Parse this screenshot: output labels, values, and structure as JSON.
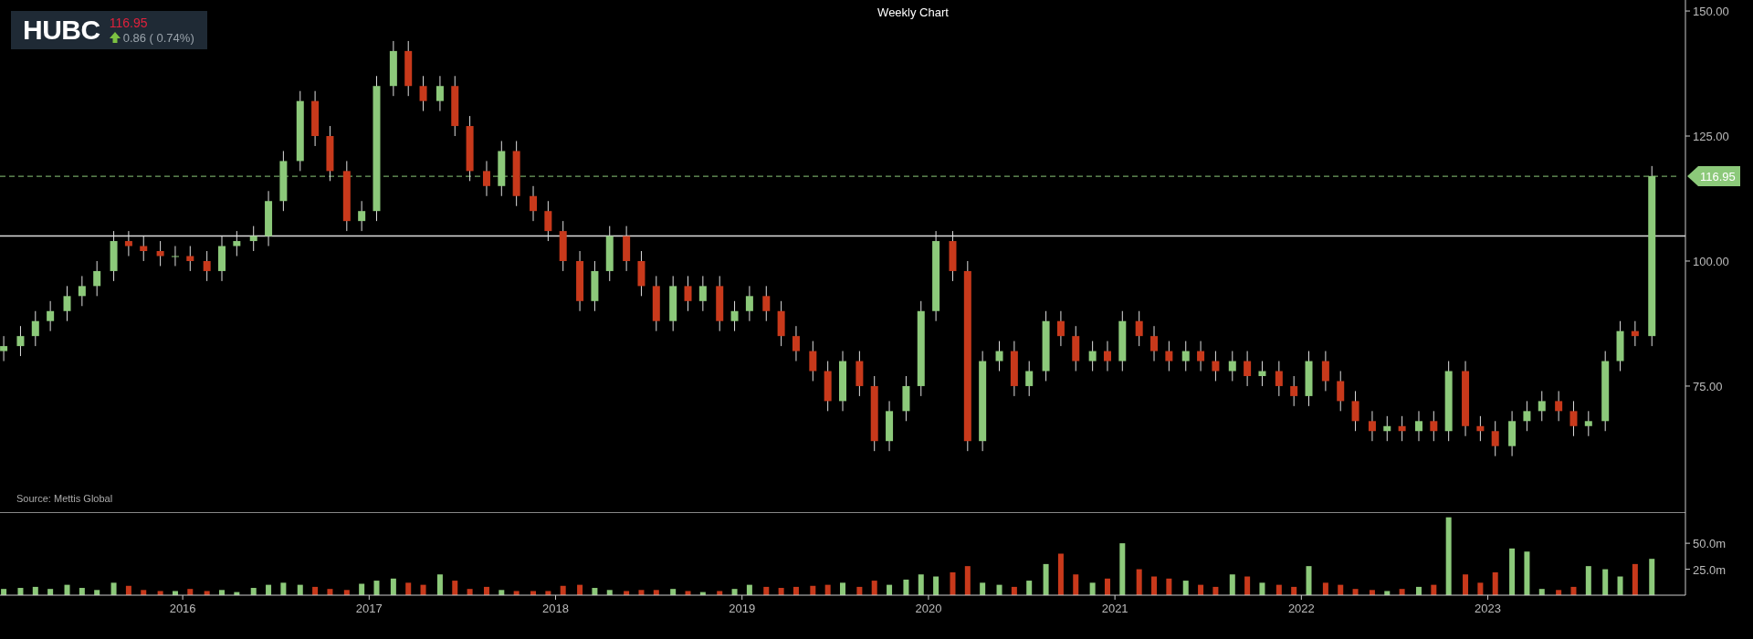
{
  "ticker": {
    "symbol": "HUBC",
    "price": "116.95",
    "change": "0.86 ( 0.74%)",
    "up": true
  },
  "price_chart": {
    "chart_data": {
      "type": "candlestick",
      "title": "Weekly Chart",
      "x": [
        2015.04,
        2015.13,
        2015.21,
        2015.29,
        2015.38,
        2015.46,
        2015.54,
        2015.63,
        2015.71,
        2015.79,
        2015.88,
        2015.96,
        2016.04,
        2016.13,
        2016.21,
        2016.29,
        2016.38,
        2016.46,
        2016.54,
        2016.63,
        2016.71,
        2016.79,
        2016.88,
        2016.96,
        2017.04,
        2017.13,
        2017.21,
        2017.29,
        2017.38,
        2017.46,
        2017.54,
        2017.63,
        2017.71,
        2017.79,
        2017.88,
        2017.96,
        2018.04,
        2018.13,
        2018.21,
        2018.29,
        2018.38,
        2018.46,
        2018.54,
        2018.63,
        2018.71,
        2018.79,
        2018.88,
        2018.96,
        2019.04,
        2019.13,
        2019.21,
        2019.29,
        2019.38,
        2019.46,
        2019.54,
        2019.63,
        2019.71,
        2019.79,
        2019.88,
        2019.96,
        2020.04,
        2020.13,
        2020.21,
        2020.29,
        2020.38,
        2020.46,
        2020.54,
        2020.63,
        2020.71,
        2020.79,
        2020.88,
        2020.96,
        2021.04,
        2021.13,
        2021.21,
        2021.29,
        2021.38,
        2021.46,
        2021.54,
        2021.63,
        2021.71,
        2021.79,
        2021.88,
        2021.96,
        2022.04,
        2022.13,
        2022.21,
        2022.29,
        2022.38,
        2022.46,
        2022.54,
        2022.63,
        2022.71,
        2022.79,
        2022.88,
        2022.96,
        2023.04,
        2023.13,
        2023.21,
        2023.29,
        2023.38,
        2023.46,
        2023.54,
        2023.63,
        2023.71,
        2023.79,
        2023.88
      ],
      "ohlc": [
        [
          82,
          85,
          80,
          83
        ],
        [
          83,
          87,
          81,
          85
        ],
        [
          85,
          90,
          83,
          88
        ],
        [
          88,
          92,
          86,
          90
        ],
        [
          90,
          95,
          88,
          93
        ],
        [
          93,
          97,
          91,
          95
        ],
        [
          95,
          100,
          93,
          98
        ],
        [
          98,
          106,
          96,
          104
        ],
        [
          104,
          106,
          101,
          103
        ],
        [
          103,
          105,
          100,
          102
        ],
        [
          102,
          104,
          99,
          101
        ],
        [
          101,
          103,
          99,
          101
        ],
        [
          101,
          103,
          98,
          100
        ],
        [
          100,
          102,
          96,
          98
        ],
        [
          98,
          105,
          96,
          103
        ],
        [
          103,
          106,
          101,
          104
        ],
        [
          104,
          107,
          102,
          105
        ],
        [
          105,
          114,
          103,
          112
        ],
        [
          112,
          122,
          110,
          120
        ],
        [
          120,
          134,
          118,
          132
        ],
        [
          132,
          134,
          123,
          125
        ],
        [
          125,
          127,
          116,
          118
        ],
        [
          118,
          120,
          106,
          108
        ],
        [
          108,
          112,
          106,
          110
        ],
        [
          110,
          137,
          108,
          135
        ],
        [
          135,
          144,
          133,
          142
        ],
        [
          142,
          144,
          133,
          135
        ],
        [
          135,
          137,
          130,
          132
        ],
        [
          132,
          137,
          130,
          135
        ],
        [
          135,
          137,
          125,
          127
        ],
        [
          127,
          129,
          116,
          118
        ],
        [
          118,
          120,
          113,
          115
        ],
        [
          115,
          124,
          113,
          122
        ],
        [
          122,
          124,
          111,
          113
        ],
        [
          113,
          115,
          108,
          110
        ],
        [
          110,
          112,
          104,
          106
        ],
        [
          106,
          108,
          98,
          100
        ],
        [
          100,
          102,
          90,
          92
        ],
        [
          92,
          100,
          90,
          98
        ],
        [
          98,
          107,
          96,
          105
        ],
        [
          105,
          107,
          98,
          100
        ],
        [
          100,
          102,
          93,
          95
        ],
        [
          95,
          97,
          86,
          88
        ],
        [
          88,
          97,
          86,
          95
        ],
        [
          95,
          97,
          90,
          92
        ],
        [
          92,
          97,
          90,
          95
        ],
        [
          95,
          97,
          86,
          88
        ],
        [
          88,
          92,
          86,
          90
        ],
        [
          90,
          95,
          88,
          93
        ],
        [
          93,
          95,
          88,
          90
        ],
        [
          90,
          92,
          83,
          85
        ],
        [
          85,
          87,
          80,
          82
        ],
        [
          82,
          84,
          76,
          78
        ],
        [
          78,
          80,
          70,
          72
        ],
        [
          72,
          82,
          70,
          80
        ],
        [
          80,
          82,
          73,
          75
        ],
        [
          75,
          77,
          62,
          64
        ],
        [
          64,
          72,
          62,
          70
        ],
        [
          70,
          77,
          68,
          75
        ],
        [
          75,
          92,
          73,
          90
        ],
        [
          90,
          106,
          88,
          104
        ],
        [
          104,
          106,
          96,
          98
        ],
        [
          98,
          100,
          62,
          64
        ],
        [
          64,
          82,
          62,
          80
        ],
        [
          80,
          84,
          78,
          82
        ],
        [
          82,
          84,
          73,
          75
        ],
        [
          75,
          80,
          73,
          78
        ],
        [
          78,
          90,
          76,
          88
        ],
        [
          88,
          90,
          83,
          85
        ],
        [
          85,
          87,
          78,
          80
        ],
        [
          80,
          84,
          78,
          82
        ],
        [
          82,
          84,
          78,
          80
        ],
        [
          80,
          90,
          78,
          88
        ],
        [
          88,
          90,
          83,
          85
        ],
        [
          85,
          87,
          80,
          82
        ],
        [
          82,
          84,
          78,
          80
        ],
        [
          80,
          84,
          78,
          82
        ],
        [
          82,
          84,
          78,
          80
        ],
        [
          80,
          82,
          76,
          78
        ],
        [
          78,
          82,
          76,
          80
        ],
        [
          80,
          82,
          75,
          77
        ],
        [
          77,
          80,
          75,
          78
        ],
        [
          78,
          80,
          73,
          75
        ],
        [
          75,
          77,
          71,
          73
        ],
        [
          73,
          82,
          71,
          80
        ],
        [
          80,
          82,
          74,
          76
        ],
        [
          76,
          78,
          70,
          72
        ],
        [
          72,
          74,
          66,
          68
        ],
        [
          68,
          70,
          64,
          66
        ],
        [
          66,
          69,
          64,
          67
        ],
        [
          67,
          69,
          64,
          66
        ],
        [
          66,
          70,
          64,
          68
        ],
        [
          68,
          70,
          64,
          66
        ],
        [
          66,
          80,
          64,
          78
        ],
        [
          78,
          80,
          65,
          67
        ],
        [
          67,
          69,
          64,
          66
        ],
        [
          66,
          68,
          61,
          63
        ],
        [
          63,
          70,
          61,
          68
        ],
        [
          68,
          72,
          66,
          70
        ],
        [
          70,
          74,
          68,
          72
        ],
        [
          72,
          74,
          68,
          70
        ],
        [
          70,
          72,
          65,
          67
        ],
        [
          67,
          70,
          65,
          68
        ],
        [
          68,
          82,
          66,
          80
        ],
        [
          80,
          88,
          78,
          86
        ],
        [
          86,
          88,
          83,
          85
        ],
        [
          85,
          119,
          83,
          117
        ]
      ],
      "xlim": [
        2015.02,
        2024.06
      ],
      "ylim": [
        49.8,
        152.2
      ],
      "xticks": [
        {
          "value": 2016,
          "label": "2016"
        },
        {
          "value": 2017,
          "label": "2017"
        },
        {
          "value": 2018,
          "label": "2018"
        },
        {
          "value": 2019,
          "label": "2019"
        },
        {
          "value": 2020,
          "label": "2020"
        },
        {
          "value": 2021,
          "label": "2021"
        },
        {
          "value": 2022,
          "label": "2022"
        },
        {
          "value": 2023,
          "label": "2023"
        }
      ],
      "yticks": [
        {
          "value": 150,
          "label": "150.00"
        },
        {
          "value": 125,
          "label": "125.00"
        },
        {
          "value": 100,
          "label": "100.00"
        },
        {
          "value": 75,
          "label": "75.00"
        }
      ],
      "ref_lines": [
        {
          "axis": "y",
          "value": 105,
          "color": "#dddddd"
        },
        {
          "axis": "y",
          "value": 116.95,
          "color": "#8cc97a",
          "line_style": "dashed",
          "label": "116.95"
        }
      ]
    },
    "source": "Source: Mettis Global"
  },
  "volume_chart": {
    "chart_data": {
      "type": "bar",
      "x": [
        2015.04,
        2015.13,
        2015.21,
        2015.29,
        2015.38,
        2015.46,
        2015.54,
        2015.63,
        2015.71,
        2015.79,
        2015.88,
        2015.96,
        2016.04,
        2016.13,
        2016.21,
        2016.29,
        2016.38,
        2016.46,
        2016.54,
        2016.63,
        2016.71,
        2016.79,
        2016.88,
        2016.96,
        2017.04,
        2017.13,
        2017.21,
        2017.29,
        2017.38,
        2017.46,
        2017.54,
        2017.63,
        2017.71,
        2017.79,
        2017.88,
        2017.96,
        2018.04,
        2018.13,
        2018.21,
        2018.29,
        2018.38,
        2018.46,
        2018.54,
        2018.63,
        2018.71,
        2018.79,
        2018.88,
        2018.96,
        2019.04,
        2019.13,
        2019.21,
        2019.29,
        2019.38,
        2019.46,
        2019.54,
        2019.63,
        2019.71,
        2019.79,
        2019.88,
        2019.96,
        2020.04,
        2020.13,
        2020.21,
        2020.29,
        2020.38,
        2020.46,
        2020.54,
        2020.63,
        2020.71,
        2020.79,
        2020.88,
        2020.96,
        2021.04,
        2021.13,
        2021.21,
        2021.29,
        2021.38,
        2021.46,
        2021.54,
        2021.63,
        2021.71,
        2021.79,
        2021.88,
        2021.96,
        2022.04,
        2022.13,
        2022.21,
        2022.29,
        2022.38,
        2022.46,
        2022.54,
        2022.63,
        2022.71,
        2022.79,
        2022.88,
        2022.96,
        2023.04,
        2023.13,
        2023.21,
        2023.29,
        2023.38,
        2023.46,
        2023.54,
        2023.63,
        2023.71,
        2023.79,
        2023.88
      ],
      "values": [
        6,
        7,
        8,
        6,
        10,
        7,
        5,
        12,
        9,
        5,
        4,
        4,
        6,
        4,
        5,
        3,
        7,
        10,
        12,
        10,
        8,
        6,
        5,
        11,
        14,
        16,
        12,
        10,
        20,
        14,
        6,
        8,
        5,
        4,
        4,
        4,
        9,
        10,
        7,
        5,
        4,
        5,
        5,
        6,
        4,
        3,
        4,
        6,
        10,
        8,
        7,
        8,
        9,
        10,
        12,
        8,
        14,
        10,
        15,
        20,
        18,
        22,
        28,
        12,
        10,
        8,
        14,
        30,
        40,
        20,
        12,
        16,
        50,
        25,
        18,
        16,
        14,
        10,
        8,
        20,
        18,
        12,
        10,
        8,
        28,
        12,
        10,
        6,
        5,
        4,
        6,
        8,
        10,
        75,
        20,
        12,
        22,
        45,
        42,
        6,
        5,
        8,
        28,
        25,
        18,
        30,
        35
      ],
      "xlim": [
        2015.02,
        2024.06
      ],
      "ylim": [
        0,
        80
      ],
      "yticks": [
        {
          "value": 50,
          "label": "50.0m"
        },
        {
          "value": 25,
          "label": "25.0m"
        }
      ]
    }
  }
}
